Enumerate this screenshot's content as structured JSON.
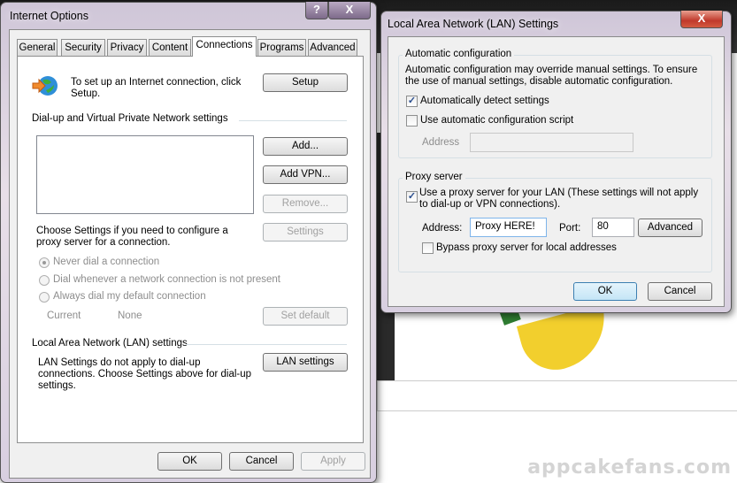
{
  "internet_options": {
    "title": "Internet Options",
    "help_label": "?",
    "close_label": "X",
    "tabs": [
      "General",
      "Security",
      "Privacy",
      "Content",
      "Connections",
      "Programs",
      "Advanced"
    ],
    "selected_tab": "Connections",
    "setup_text": "To set up an Internet connection, click Setup.",
    "setup_button": "Setup",
    "dialup_header": "Dial-up and Virtual Private Network settings",
    "add_button": "Add...",
    "add_vpn_button": "Add VPN...",
    "remove_button": "Remove...",
    "settings_text": "Choose Settings if you need to configure a proxy server for a connection.",
    "settings_button": "Settings",
    "radios": [
      "Never dial a connection",
      "Dial whenever a network connection is not present",
      "Always dial my default connection"
    ],
    "current_label": "Current",
    "current_value": "None",
    "set_default_button": "Set default",
    "lan_header": "Local Area Network (LAN) settings",
    "lan_text": "LAN Settings do not apply to dial-up connections. Choose Settings above for dial-up settings.",
    "lan_button": "LAN settings",
    "ok": "OK",
    "cancel": "Cancel",
    "apply": "Apply"
  },
  "lan_settings": {
    "title": "Local Area Network (LAN) Settings",
    "close_label": "X",
    "auto_group": "Automatic configuration",
    "auto_desc": "Automatic configuration may override manual settings.  To ensure the use of manual settings, disable automatic configuration.",
    "auto_detect": {
      "label": "Automatically detect settings",
      "checked": true
    },
    "auto_script": {
      "label": "Use automatic configuration script",
      "checked": false
    },
    "address_label": "Address",
    "address_value": "",
    "proxy_group": "Proxy server",
    "use_proxy": {
      "label": "Use a proxy server for your LAN (These settings will not apply to dial-up or VPN connections).",
      "checked": true
    },
    "proxy_address_label": "Address:",
    "proxy_address_value": "Proxy HERE!",
    "port_label": "Port:",
    "port_value": "80",
    "advanced_button": "Advanced",
    "bypass": {
      "label": "Bypass proxy server for local addresses",
      "checked": false
    },
    "ok": "OK",
    "cancel": "Cancel"
  },
  "watermark": "appcakefans.com"
}
